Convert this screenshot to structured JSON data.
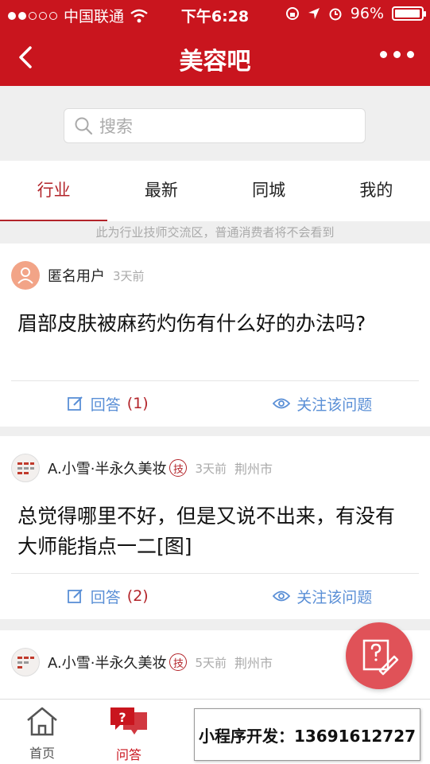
{
  "status_bar": {
    "carrier": "中国联通",
    "time": "下午6:28",
    "battery": "96%",
    "battery_level": 0.96
  },
  "nav": {
    "title": "美容吧",
    "back_icon": "chevron-left-icon",
    "more_icon": "more-dots-icon"
  },
  "search": {
    "placeholder": "搜索"
  },
  "tabs": [
    {
      "label": "行业",
      "active": true
    },
    {
      "label": "最新",
      "active": false
    },
    {
      "label": "同城",
      "active": false
    },
    {
      "label": "我的",
      "active": false
    }
  ],
  "notice": "此为行业技师交流区，普通消费者将不会看到",
  "posts": [
    {
      "user": "匿名用户",
      "badge": "",
      "time": "3天前",
      "city": "",
      "question": "眉部皮肤被麻药灼伤有什么好的办法吗?",
      "answer_label": "回答",
      "answer_count": "(1)",
      "follow_label": "关注该问题"
    },
    {
      "user": "A.小雪·半永久美妆",
      "badge": "技",
      "time": "3天前",
      "city": "荆州市",
      "question": "总觉得哪里不好，但是又说不出来，有没有大师能指点一二[图]",
      "answer_label": "回答",
      "answer_count": "(2)",
      "follow_label": "关注该问题"
    },
    {
      "user": "A.小雪·半永久美妆",
      "badge": "技",
      "time": "5天前",
      "city": "荆州市"
    }
  ],
  "bottom_tabs": [
    {
      "label": "首页",
      "icon": "home-icon",
      "active": false
    },
    {
      "label": "问答",
      "icon": "qa-icon",
      "active": true
    }
  ],
  "watermark": "小程序开发：13691612727",
  "colors": {
    "brand_red": "#c9151e",
    "accent_red": "#b3242a",
    "link_blue": "#5a8fd6"
  }
}
